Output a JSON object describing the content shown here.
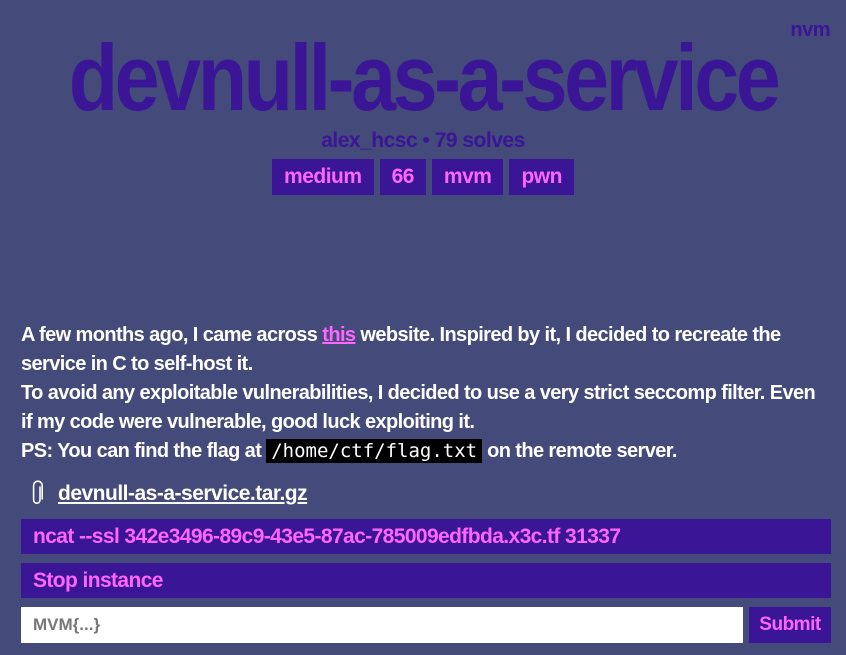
{
  "corner_tag": "nvm",
  "challenge": {
    "title": "devnull-as-a-service",
    "author": "alex_hcsc",
    "separator": "•",
    "solves": "79 solves",
    "tags": [
      "medium",
      "66",
      "mvm",
      "pwn"
    ]
  },
  "description": {
    "line1_before": "A few months ago, I came across ",
    "line1_link": "this",
    "line1_after": " website. Inspired by it, I decided to recreate the service in C to self-host it.",
    "line2": "To avoid any exploitable vulnerabilities, I decided to use a very strict seccomp filter. Even if my code were vulnerable, good luck exploiting it.",
    "line3_before": "PS: You can find the flag at ",
    "line3_code": "/home/ctf/flag.txt",
    "line3_after": " on the remote server."
  },
  "attachment": {
    "icon": "paperclip-icon",
    "filename": "devnull-as-a-service.tar.gz"
  },
  "instance": {
    "connection": "ncat --ssl 342e3496-89c9-43e5-87ac-785009edfbda.x3c.tf 31337",
    "stop_label": "Stop instance"
  },
  "flag_form": {
    "placeholder": "MVM{...}",
    "value": "",
    "submit_label": "Submit"
  },
  "colors": {
    "background": "#444a7a",
    "accent": "#3a1596",
    "highlight": "#ff66ff",
    "text": "#ffffff"
  }
}
